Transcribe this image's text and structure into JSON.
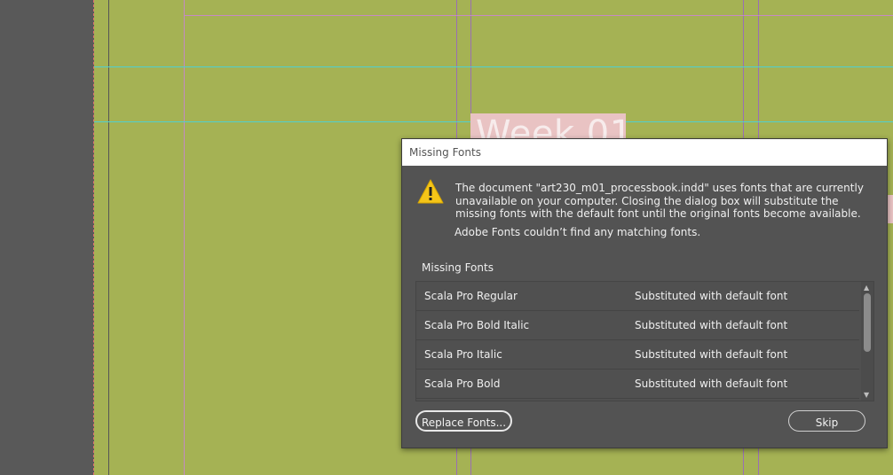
{
  "canvas": {
    "heading_text": "Week 01",
    "page_color": "#a5b254",
    "pasteboard_color": "#595959"
  },
  "dialog": {
    "title": "Missing Fonts",
    "icon": "warning-icon",
    "message": "The document \"art230_m01_processbook.indd\" uses fonts that are currently unavailable on your computer. Closing the dialog box will substitute the missing fonts with the default font until the original fonts become available.",
    "note": "Adobe Fonts couldn’t find any matching fonts.",
    "section_label": "Missing Fonts",
    "fonts": [
      {
        "name": "Scala Pro Regular",
        "status": "Substituted with default font"
      },
      {
        "name": "Scala Pro Bold Italic",
        "status": "Substituted with default font"
      },
      {
        "name": "Scala Pro Italic",
        "status": "Substituted with default font"
      },
      {
        "name": "Scala Pro Bold",
        "status": "Substituted with default font"
      }
    ],
    "replace_button": "Replace Fonts...",
    "skip_button": "Skip"
  }
}
